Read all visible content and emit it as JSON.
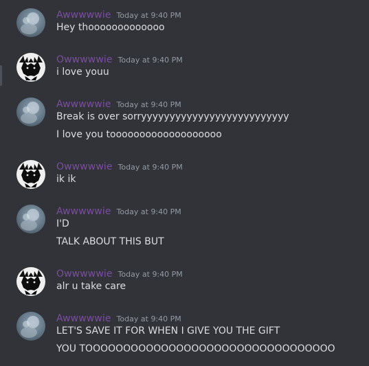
{
  "messages": [
    {
      "author": "Awwwwwie",
      "timestamp": "Today at 9:40 PM",
      "avatar": "avatar-a",
      "lines": [
        "Hey thooooooooooooo"
      ]
    },
    {
      "author": "Owwwwwie",
      "timestamp": "Today at 9:40 PM",
      "avatar": "avatar-b",
      "lines": [
        "i love youu"
      ]
    },
    {
      "author": "Awwwwwie",
      "timestamp": "Today at 9:40 PM",
      "avatar": "avatar-a",
      "lines": [
        "Break is over sorryyyyyyyyyyyyyyyyyyyyyyyyyy",
        "I love you tooooooooooooooooooo"
      ]
    },
    {
      "author": "Owwwwwie",
      "timestamp": "Today at 9:40 PM",
      "avatar": "avatar-b",
      "lines": [
        "ik ik"
      ]
    },
    {
      "author": "Awwwwwie",
      "timestamp": "Today at 9:40 PM",
      "avatar": "avatar-a",
      "lines": [
        "I'D",
        "TALK ABOUT THIS BUT"
      ]
    },
    {
      "author": "Owwwwwie",
      "timestamp": "Today at 9:40 PM",
      "avatar": "avatar-b",
      "lines": [
        "alr u take care"
      ]
    },
    {
      "author": "Awwwwwie",
      "timestamp": "Today at 9:40 PM",
      "avatar": "avatar-a",
      "lines": [
        "LET'S SAVE IT FOR WHEN I GIVE YOU THE GIFT",
        "YOU TOOOOOOOOOOOOOOOOOOOOOOOOOOOOOOOOO"
      ]
    }
  ],
  "colors": {
    "background": "#313338",
    "author": "#7a4ea0",
    "timestamp": "#949ba4",
    "text": "#dbdee1"
  }
}
